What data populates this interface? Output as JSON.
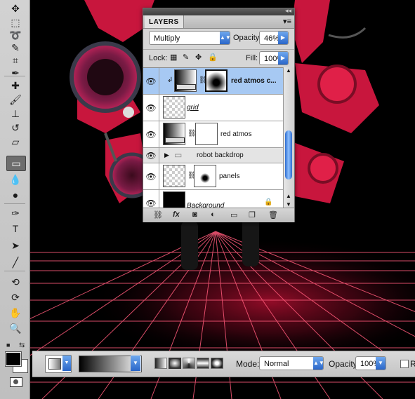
{
  "layers_panel": {
    "tab_label": "LAYERS",
    "blend_mode": "Multiply",
    "opacity_label": "Opacity:",
    "opacity_value": "46%",
    "lock_label": "Lock:",
    "fill_label": "Fill:",
    "fill_value": "100%",
    "layers": [
      {
        "name": "red atmos c...",
        "selected": true,
        "clipped": true,
        "has_mask": true
      },
      {
        "name": "grid",
        "selected": false,
        "clipped": false,
        "has_mask": false
      },
      {
        "name": "red atmos",
        "selected": false,
        "clipped": false,
        "has_mask": true
      },
      {
        "name": "robot backdrop",
        "selected": false,
        "is_group": true
      },
      {
        "name": "panels",
        "selected": false,
        "clipped": false,
        "has_mask": true
      },
      {
        "name": "Background",
        "selected": false,
        "locked": true
      }
    ],
    "footer_icons": [
      "link-icon",
      "fx-icon",
      "add-mask-icon",
      "adjustment-icon",
      "new-group-icon",
      "new-layer-icon",
      "trash-icon"
    ]
  },
  "options_bar": {
    "mode_label": "Mode:",
    "mode_value": "Normal",
    "opacity_label": "Opacity:",
    "opacity_value": "100%",
    "reverse_label": "Re"
  },
  "tools": [
    "move",
    "marquee",
    "lasso",
    "quick-select",
    "crop",
    "eyedropper",
    "healing",
    "brush",
    "clone-stamp",
    "history-brush",
    "eraser",
    "gradient",
    "blur",
    "dodge",
    "pen",
    "type",
    "path-select",
    "line",
    "3d-rotate",
    "3d-orbit",
    "hand",
    "zoom"
  ],
  "colors": {
    "foreground": "#000000",
    "background": "#ffffff",
    "accent_red": "#e8163c",
    "selection_blue": "#a7c9f3"
  }
}
